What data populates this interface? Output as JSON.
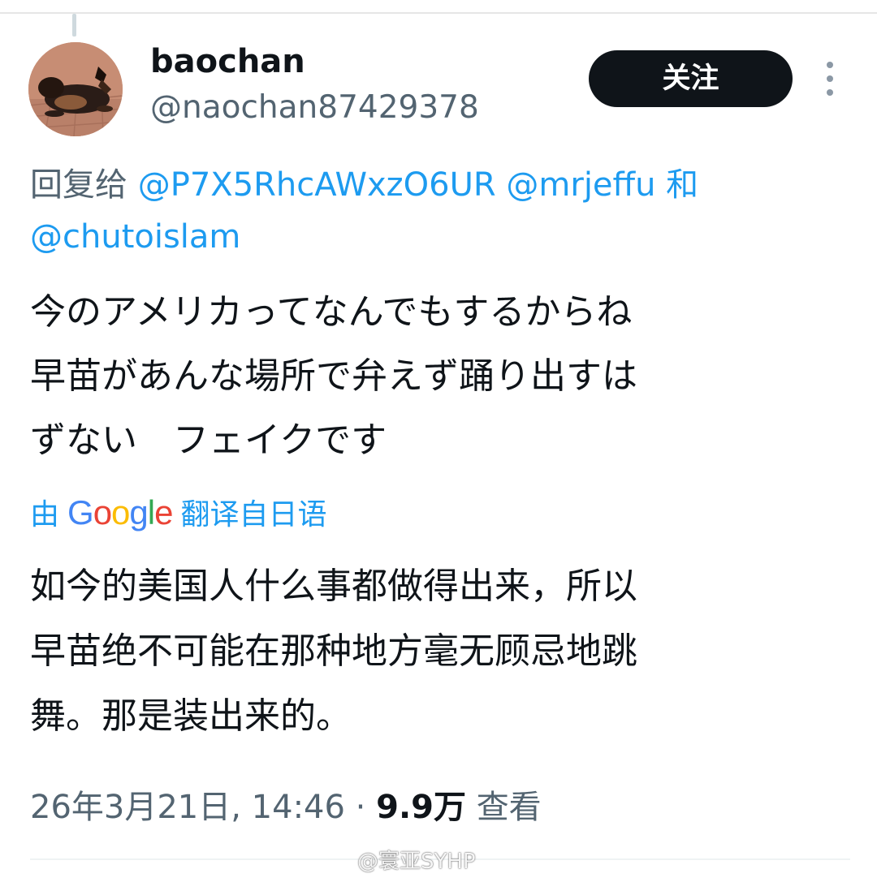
{
  "tweet": {
    "author": {
      "display_name": "baochan",
      "handle": "@naochan87429378",
      "avatar_icon": "dog-photo-avatar"
    },
    "follow_label": "关注",
    "more_icon": "more-vertical-icon",
    "reply": {
      "prefix": "回复给",
      "mention_1": "@P7X5RhcAWxzO6UR",
      "mention_2": "@mrjeffu",
      "conjunction": "和",
      "mention_3": "@chutoislam"
    },
    "text_lines": [
      "今のアメリカってなんでもするからね",
      "早苗があんな場所で弁えず踊り出すは",
      "ずない　フェイクです"
    ],
    "translation": {
      "prefix": "由",
      "provider": "Google",
      "suffix": "翻译自日语"
    },
    "translated_lines": [
      "如今的美国人什么事都做得出来，所以",
      "早苗绝不可能在那种地方毫无顾忌地跳",
      "舞。那是装出来的。"
    ],
    "meta": {
      "timestamp": "26年3月21日, 14:46",
      "separator": "·",
      "views_count": "9.9万",
      "views_label": "查看"
    }
  },
  "watermark": "@寰亚SYHP",
  "colors": {
    "text": "#0f1419",
    "secondary": "#536471",
    "link": "#1d9bf0",
    "button_bg": "#0f1419",
    "button_text": "#ffffff"
  }
}
